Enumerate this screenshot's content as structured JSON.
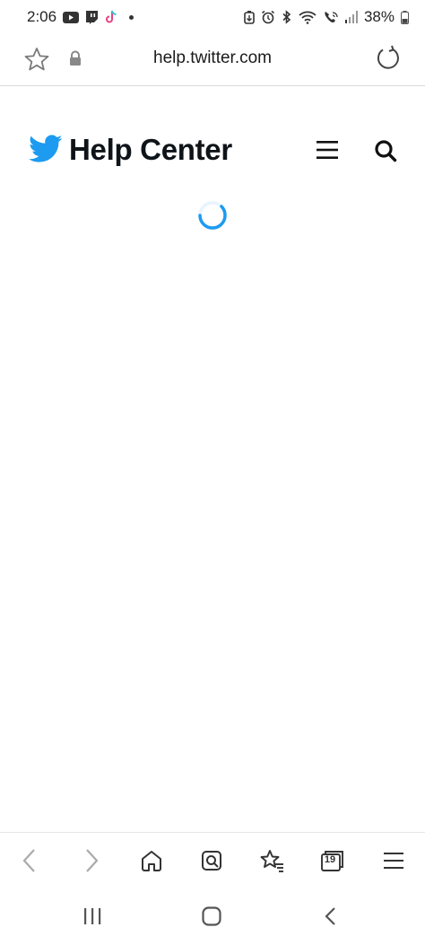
{
  "status_bar": {
    "time": "2:06",
    "battery_percent": "38%",
    "left_icons": [
      "youtube-icon",
      "twitch-icon",
      "tiktok-icon",
      "notification-dot"
    ],
    "right_icons": [
      "battery-saver-icon",
      "alarm-icon",
      "bluetooth-icon",
      "wifi-icon",
      "wifi-calling-icon",
      "signal-icon",
      "battery-icon"
    ]
  },
  "browser": {
    "url": "help.twitter.com",
    "tabs_count": "19"
  },
  "page": {
    "title": "Help Center",
    "brand_color": "#1d9bf0",
    "loading": true
  },
  "toolbar": {
    "items": [
      "back-icon",
      "forward-icon",
      "home-icon",
      "bookmark-search-icon",
      "bookmarks-icon",
      "tabs-icon",
      "menu-icon"
    ]
  }
}
